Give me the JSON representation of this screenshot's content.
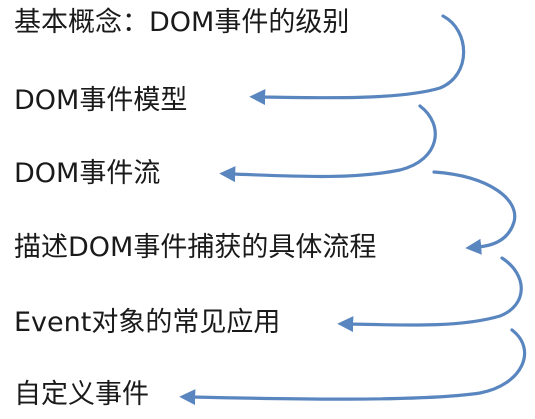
{
  "topics": [
    "基本概念：DOM事件的级别",
    "DOM事件模型",
    "DOM事件流",
    "描述DOM事件捕获的具体流程",
    "Event对象的常见应用",
    "自定义事件"
  ],
  "colors": {
    "text": "#1a1a1a",
    "arrow": "#5a86c0",
    "background": "#ffffff"
  }
}
